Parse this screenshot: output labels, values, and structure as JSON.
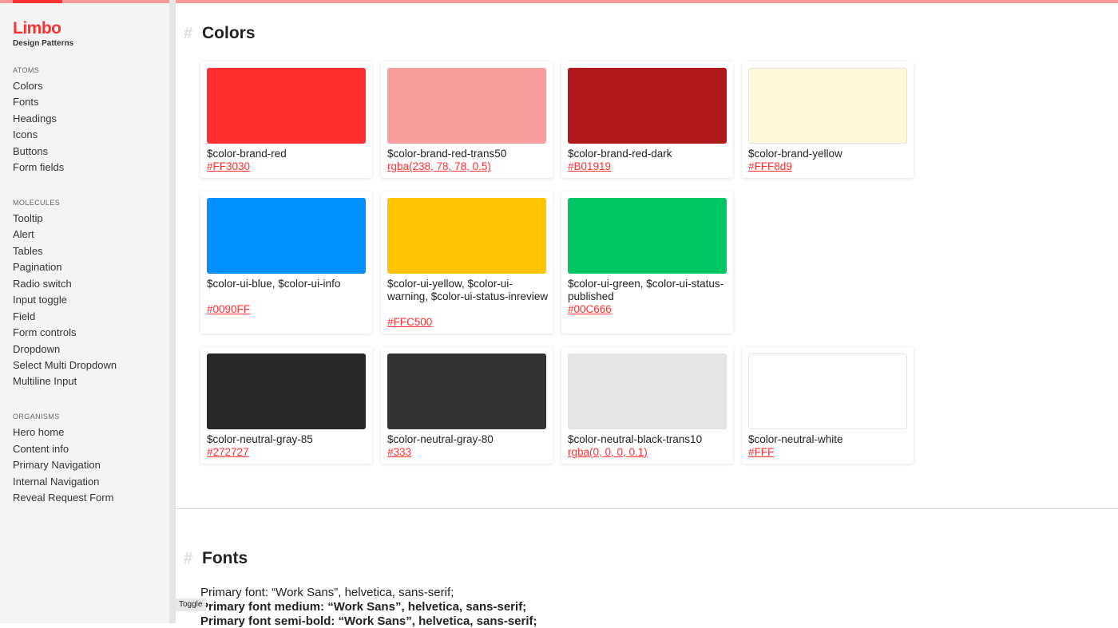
{
  "sidebar": {
    "logo": "Limbo",
    "logo_sub": "Design Patterns",
    "sections": [
      {
        "label": "ATOMS",
        "items": [
          "Colors",
          "Fonts",
          "Headings",
          "Icons",
          "Buttons",
          "Form fields"
        ]
      },
      {
        "label": "MOLECULES",
        "items": [
          "Tooltip",
          "Alert",
          "Tables",
          "Pagination",
          "Radio switch",
          "Input toggle",
          "Field",
          "Form controls",
          "Dropdown",
          "Select Multi Dropdown",
          "Multiline Input"
        ]
      },
      {
        "label": "ORGANISMS",
        "items": [
          "Hero home",
          "Content info",
          "Primary Navigation",
          "Internal Navigation",
          "Reveal Request Form"
        ]
      }
    ]
  },
  "colors_section": {
    "hash": "#",
    "title": "Colors",
    "cards": [
      {
        "swatch": "#FF3030",
        "name": "$color-brand-red",
        "value": "#FF3030"
      },
      {
        "swatch": "rgba(238, 78, 78, 0.5)",
        "name": "$color-brand-red-trans50",
        "value": "rgba(238, 78, 78, 0.5)"
      },
      {
        "swatch": "#B01919",
        "name": "$color-brand-red-dark",
        "value": "#B01919"
      },
      {
        "swatch": "#FFF8d9",
        "name": "$color-brand-yellow",
        "value": "#FFF8d9"
      },
      {
        "swatch": "#0090FF",
        "name": "$color-ui-blue, $color-ui-info",
        "value": "#0090FF"
      },
      {
        "swatch": "#FFC500",
        "name": "$color-ui-yellow, $color-ui-warning, $color-ui-status-inreview",
        "value": "#FFC500"
      },
      {
        "swatch": "#00C666",
        "name": "$color-ui-green, $color-ui-status-published",
        "value": "#00C666"
      },
      {
        "swatch": "#272727",
        "name": "$color-neutral-gray-85",
        "value": "#272727"
      },
      {
        "swatch": "#333",
        "name": "$color-neutral-gray-80",
        "value": "#333"
      },
      {
        "swatch": "rgba(0, 0, 0, 0.1)",
        "name": "$color-neutral-black-trans10",
        "value": "rgba(0, 0, 0, 0.1)"
      },
      {
        "swatch": "#FFF",
        "name": "$color-neutral-white",
        "value": "#FFF"
      }
    ]
  },
  "fonts_section": {
    "hash": "#",
    "title": "Fonts",
    "lines": [
      "Primary font: “Work Sans”, helvetica, sans-serif;",
      "Primary font medium: “Work Sans”, helvetica, sans-serif;",
      "Primary font semi-bold: “Work Sans”, helvetica, sans-serif;"
    ]
  },
  "toggle_label": "Toggle",
  "theme": {
    "accent": "#FF3030",
    "topbar": "#F59A9A"
  }
}
